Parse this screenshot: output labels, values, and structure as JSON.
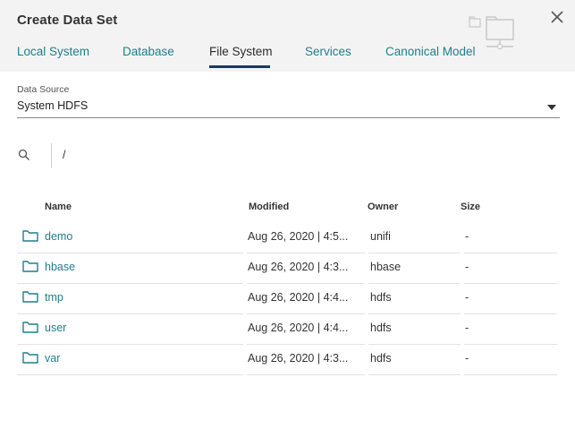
{
  "dialog": {
    "title": "Create Data Set"
  },
  "tabs": [
    {
      "label": "Local System"
    },
    {
      "label": "Database"
    },
    {
      "label": "File System"
    },
    {
      "label": "Services"
    },
    {
      "label": "Canonical Model"
    }
  ],
  "active_tab": "File System",
  "data_source": {
    "label": "Data Source",
    "value": "System HDFS"
  },
  "path": {
    "value": "/"
  },
  "table": {
    "headers": {
      "name": "Name",
      "modified": "Modified",
      "owner": "Owner",
      "size": "Size"
    },
    "rows": [
      {
        "name": "demo",
        "modified": "Aug 26, 2020 | 4:5...",
        "owner": "unifi",
        "size": "-"
      },
      {
        "name": "hbase",
        "modified": "Aug 26, 2020 | 4:3...",
        "owner": "hbase",
        "size": "-"
      },
      {
        "name": "tmp",
        "modified": "Aug 26, 2020 | 4:4...",
        "owner": "hdfs",
        "size": "-"
      },
      {
        "name": "user",
        "modified": "Aug 26, 2020 | 4:4...",
        "owner": "hdfs",
        "size": "-"
      },
      {
        "name": "var",
        "modified": "Aug 26, 2020 | 4:3...",
        "owner": "hdfs",
        "size": "-"
      }
    ]
  },
  "colors": {
    "accent": "#1f7f8c",
    "tab_indicator": "#1b3a5e",
    "header_bg": "#f3f3f3"
  }
}
